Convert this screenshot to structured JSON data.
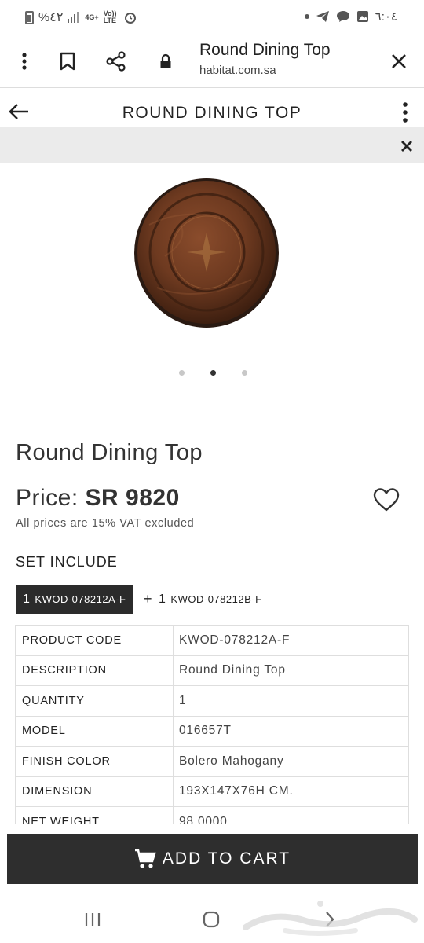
{
  "status_bar": {
    "battery_text": "%٤٢",
    "network_4g": "4G+",
    "network_volte": "Vo)) LTE",
    "time": "٦:٠٤"
  },
  "browser": {
    "title": "Round Dining Top",
    "url": "habitat.com.sa",
    "icons": [
      "more-vert-icon",
      "bookmark-icon",
      "share-icon",
      "lock-icon",
      "close-icon"
    ]
  },
  "app_header": {
    "title": "ROUND DINING TOP",
    "icons": [
      "back-arrow-icon",
      "more-vert-icon",
      "close-icon"
    ]
  },
  "carousel": {
    "count": 3,
    "active_index": 1
  },
  "product": {
    "name": "Round Dining Top",
    "price_label": "Price:",
    "price_value": "SR 9820",
    "vat_note": "All prices are 15% VAT excluded"
  },
  "set": {
    "title": "SET INCLUDE",
    "items": [
      {
        "qty": "1",
        "code": "KWOD-078212A-F"
      },
      {
        "prefix": "+",
        "qty": "1",
        "code": "KWOD-078212B-F"
      }
    ]
  },
  "specs": [
    {
      "key": "PRODUCT CODE",
      "value": "KWOD-078212A-F"
    },
    {
      "key": "DESCRIPTION",
      "value": "Round Dining Top"
    },
    {
      "key": "QUANTITY",
      "value": "1"
    },
    {
      "key": "MODEL",
      "value": "016657T"
    },
    {
      "key": "FINISH COLOR",
      "value": "Bolero Mahogany"
    },
    {
      "key": "DIMENSION",
      "value": "193X147X76H CM."
    },
    {
      "key": "NET WEIGHT",
      "value": "98.0000"
    }
  ],
  "cart": {
    "label": "ADD TO CART"
  },
  "colors": {
    "dark_button": "#2e2e2e",
    "grey_bar": "#ebebeb",
    "wood": "#6b3a22"
  }
}
